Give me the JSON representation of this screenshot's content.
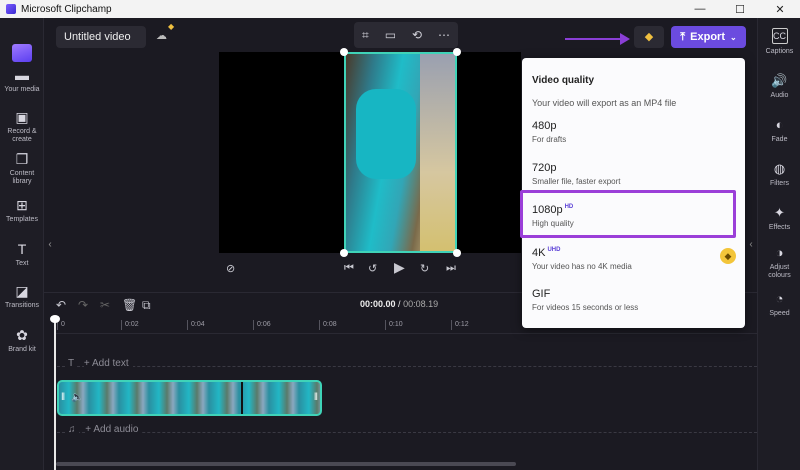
{
  "window": {
    "title": "Microsoft Clipchamp",
    "minimize": "—",
    "maximize": "☐",
    "close": "✕"
  },
  "left_nav": [
    {
      "label": "Your media",
      "icon": "folder-icon",
      "glyph": "▬"
    },
    {
      "label": "Record & create",
      "icon": "record-icon",
      "glyph": "▣"
    },
    {
      "label": "Content library",
      "icon": "library-icon",
      "glyph": "❐"
    },
    {
      "label": "Templates",
      "icon": "templates-icon",
      "glyph": "⊞"
    },
    {
      "label": "Text",
      "icon": "text-icon",
      "glyph": "T"
    },
    {
      "label": "Transitions",
      "icon": "transitions-icon",
      "glyph": "◪"
    },
    {
      "label": "Brand kit",
      "icon": "brand-kit-icon",
      "glyph": "✿"
    }
  ],
  "topbar": {
    "project_title": "Untitled video",
    "export_label": "Export",
    "tools": [
      "⌗",
      "▭",
      "⟲",
      "⋯"
    ]
  },
  "right_nav": [
    {
      "label": "Captions",
      "icon": "captions-icon",
      "glyph": "CC"
    },
    {
      "label": "Audio",
      "icon": "audio-icon",
      "glyph": "🔊"
    },
    {
      "label": "Fade",
      "icon": "fade-icon",
      "glyph": "◐"
    },
    {
      "label": "Filters",
      "icon": "filters-icon",
      "glyph": "◍"
    },
    {
      "label": "Effects",
      "icon": "effects-icon",
      "glyph": "✦"
    },
    {
      "label": "Adjust colours",
      "icon": "adjust-colours-icon",
      "glyph": "◑"
    },
    {
      "label": "Speed",
      "icon": "speed-icon",
      "glyph": "◔"
    }
  ],
  "timeline": {
    "current_time": "00:00.00",
    "total_time": "00:08.19",
    "ticks": [
      "0",
      "0:02",
      "0:04",
      "0:06",
      "0:08",
      "0:10",
      "0:12"
    ],
    "add_text": "+ Add text",
    "add_audio": "+ Add audio"
  },
  "export_menu": {
    "heading": "Video quality",
    "subheading": "Your video will export as an MP4 file",
    "options": [
      {
        "label": "480p",
        "badge": "",
        "desc": "For drafts"
      },
      {
        "label": "720p",
        "badge": "",
        "desc": "Smaller file, faster export"
      },
      {
        "label": "1080p",
        "badge": "HD",
        "desc": "High quality",
        "highlighted": true
      },
      {
        "label": "4K",
        "badge": "UHD",
        "desc": "Your video has no 4K media",
        "premium": true
      },
      {
        "label": "GIF",
        "badge": "",
        "desc": "For videos 15 seconds or less"
      }
    ]
  },
  "colors": {
    "accent": "#6b4bdf",
    "highlight": "#9b3fd8",
    "clip_border": "#3fd3b8"
  }
}
